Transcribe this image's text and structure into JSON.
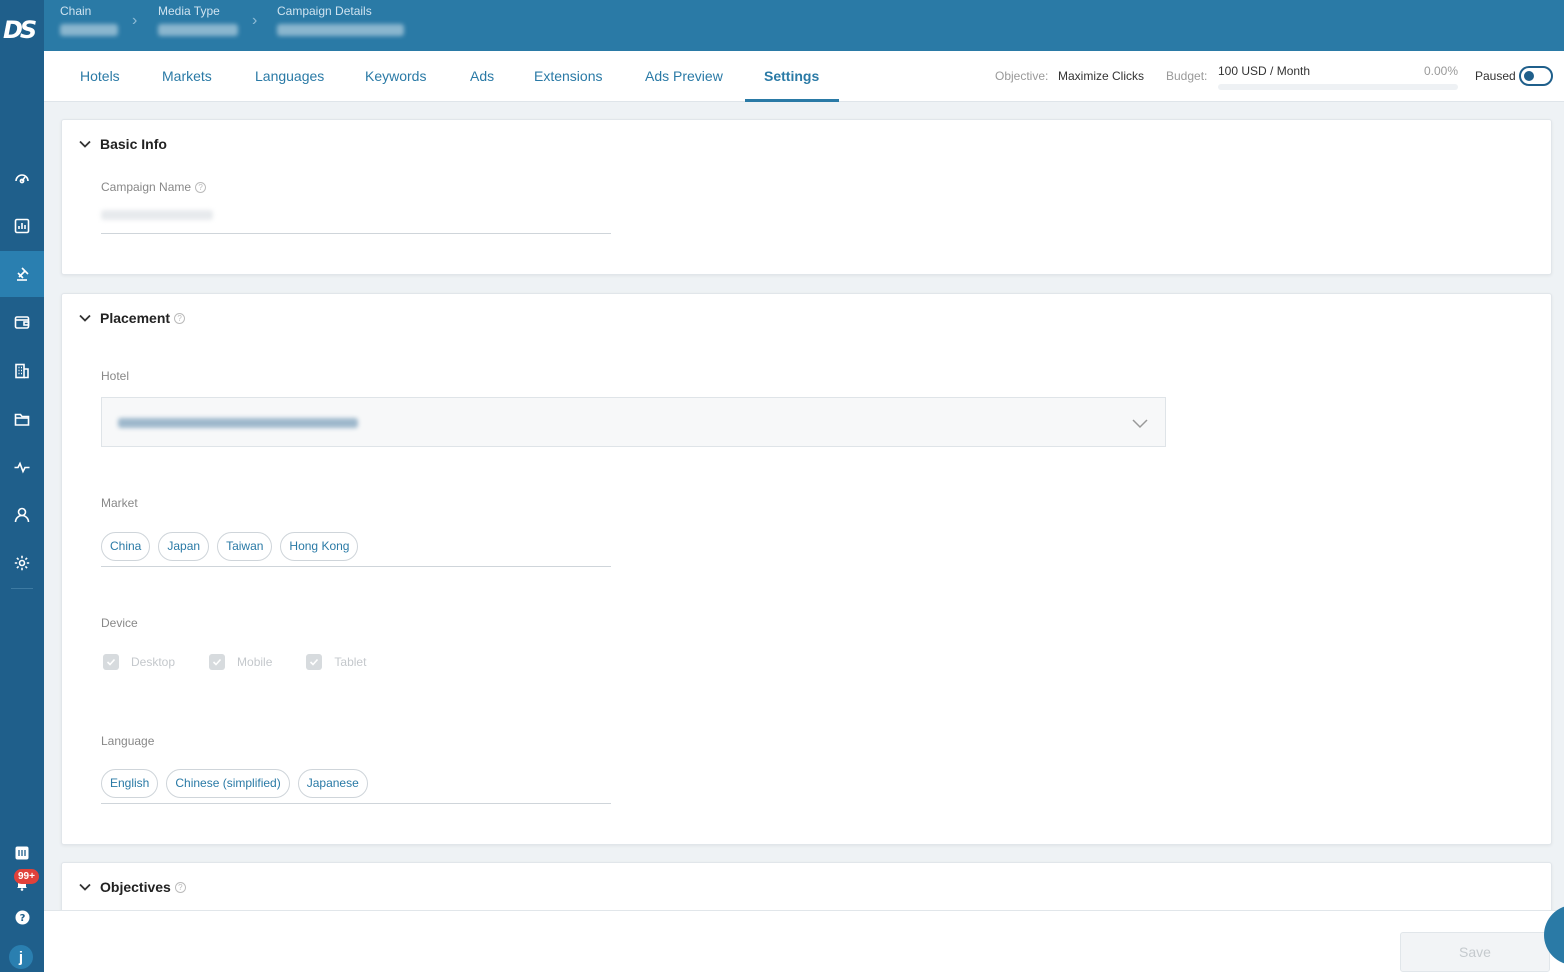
{
  "brand": {
    "logo_text": "DS",
    "primary_color": "#2a7aa6",
    "sidebar_color": "#1f5f8b"
  },
  "sidebar": {
    "items": [
      {
        "name": "dashboard-icon"
      },
      {
        "name": "reports-icon"
      },
      {
        "name": "campaigns-icon",
        "active": true
      },
      {
        "name": "wallet-icon"
      },
      {
        "name": "hotels-icon"
      },
      {
        "name": "folder-icon"
      },
      {
        "name": "activity-icon"
      },
      {
        "name": "user-icon"
      },
      {
        "name": "gear-icon"
      }
    ],
    "notifications_badge": "99+",
    "user_initial": "j"
  },
  "breadcrumb": {
    "items": [
      {
        "label": "Chain"
      },
      {
        "label": "Media Type"
      },
      {
        "label": "Campaign Details"
      }
    ]
  },
  "tabs": [
    {
      "label": "Hotels"
    },
    {
      "label": "Markets"
    },
    {
      "label": "Languages"
    },
    {
      "label": "Keywords"
    },
    {
      "label": "Ads"
    },
    {
      "label": "Extensions"
    },
    {
      "label": "Ads Preview"
    },
    {
      "label": "Settings",
      "active": true
    }
  ],
  "summary": {
    "objective_label": "Objective:",
    "objective_value": "Maximize Clicks",
    "budget_label": "Budget:",
    "budget_value": "100 USD / Month",
    "budget_pct": "0.00%",
    "budget_spent_fraction": 0,
    "status_label": "Paused"
  },
  "basic_info": {
    "title": "Basic Info",
    "campaign_name_label": "Campaign Name"
  },
  "placement": {
    "title": "Placement",
    "hotel_label": "Hotel",
    "market_label": "Market",
    "markets": [
      "China",
      "Japan",
      "Taiwan",
      "Hong Kong"
    ],
    "device_label": "Device",
    "devices": [
      "Desktop",
      "Mobile",
      "Tablet"
    ],
    "language_label": "Language",
    "languages": [
      "English",
      "Chinese (simplified)",
      "Japanese"
    ]
  },
  "objectives": {
    "title": "Objectives"
  },
  "footer": {
    "save_label": "Save"
  }
}
